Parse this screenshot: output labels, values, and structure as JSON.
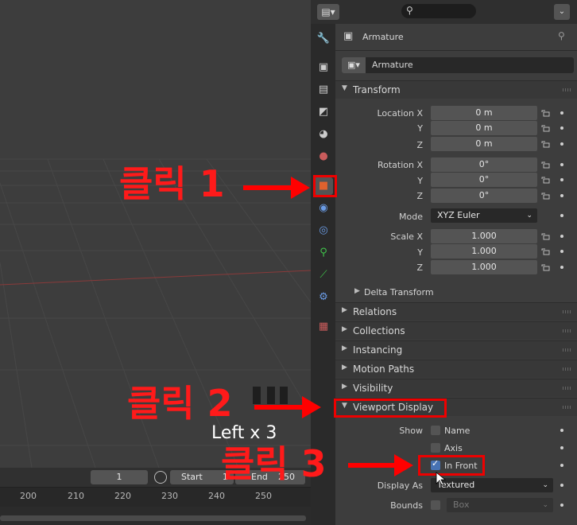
{
  "viewport": {
    "overlay_label": "Left x 3"
  },
  "timeline": {
    "current_frame": "1",
    "start_label": "Start",
    "start_value": "1",
    "end_label": "End",
    "end_value": "250",
    "ticks": [
      "200",
      "210",
      "220",
      "230",
      "240",
      "250"
    ]
  },
  "properties": {
    "object_name": "Armature",
    "datablock_name": "Armature",
    "transform": {
      "title": "Transform",
      "location_x_label": "Location X",
      "y_label": "Y",
      "z_label": "Z",
      "location": [
        "0 m",
        "0 m",
        "0 m"
      ],
      "rotation_x_label": "Rotation X",
      "rotation": [
        "0°",
        "0°",
        "0°"
      ],
      "mode_label": "Mode",
      "mode_value": "XYZ Euler",
      "scale_x_label": "Scale X",
      "scale": [
        "1.000",
        "1.000",
        "1.000"
      ],
      "delta": "Delta Transform"
    },
    "sections": [
      "Relations",
      "Collections",
      "Instancing",
      "Motion Paths",
      "Visibility"
    ],
    "viewport_display": {
      "title": "Viewport Display",
      "show_label": "Show",
      "name_label": "Name",
      "axis_label": "Axis",
      "in_front_label": "In Front",
      "display_as_label": "Display As",
      "display_as_value": "Textured",
      "bounds_label": "Bounds",
      "bounds_value": "Box"
    }
  },
  "annotations": {
    "click1": "클릭 1",
    "click2": "클릭 2",
    "click3": "클릭 3"
  },
  "colors": {
    "annotation": "#ff0000",
    "active_tab": "#e0622e",
    "checkbox_on": "#4772b3"
  }
}
